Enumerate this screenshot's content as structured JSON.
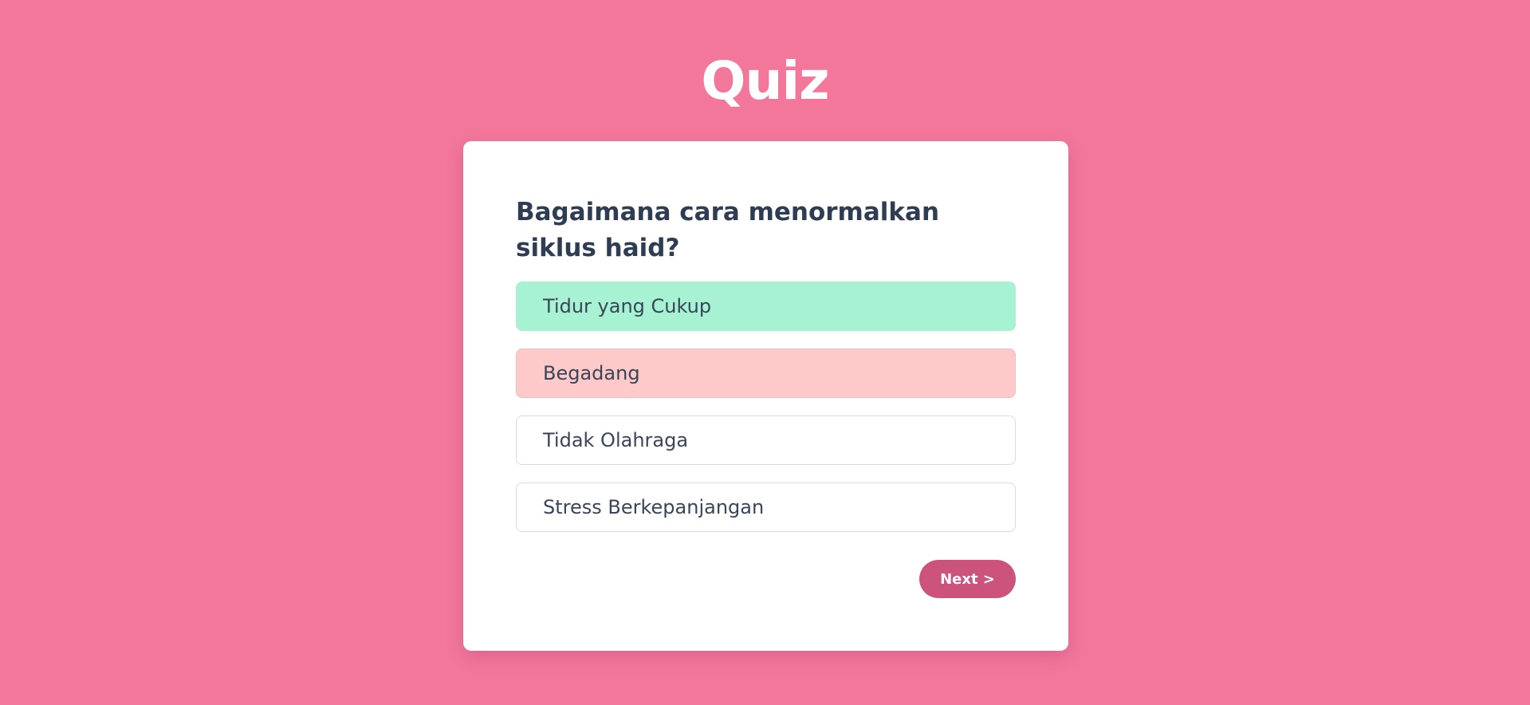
{
  "page": {
    "title": "Quiz"
  },
  "quiz": {
    "question": "Bagaimana cara menormalkan siklus haid?",
    "options": [
      {
        "label": "Tidur yang Cukup",
        "state": "correct"
      },
      {
        "label": "Begadang",
        "state": "wrong"
      },
      {
        "label": "Tidak Olahraga",
        "state": "default"
      },
      {
        "label": "Stress Berkepanjangan",
        "state": "default"
      }
    ],
    "next_label": "Next >"
  },
  "colors": {
    "background": "#f3769b",
    "card": "#ffffff",
    "correct": "#a7f2d3",
    "wrong": "#fec9c9",
    "button": "#cc537c",
    "text": "#2f3d53"
  }
}
